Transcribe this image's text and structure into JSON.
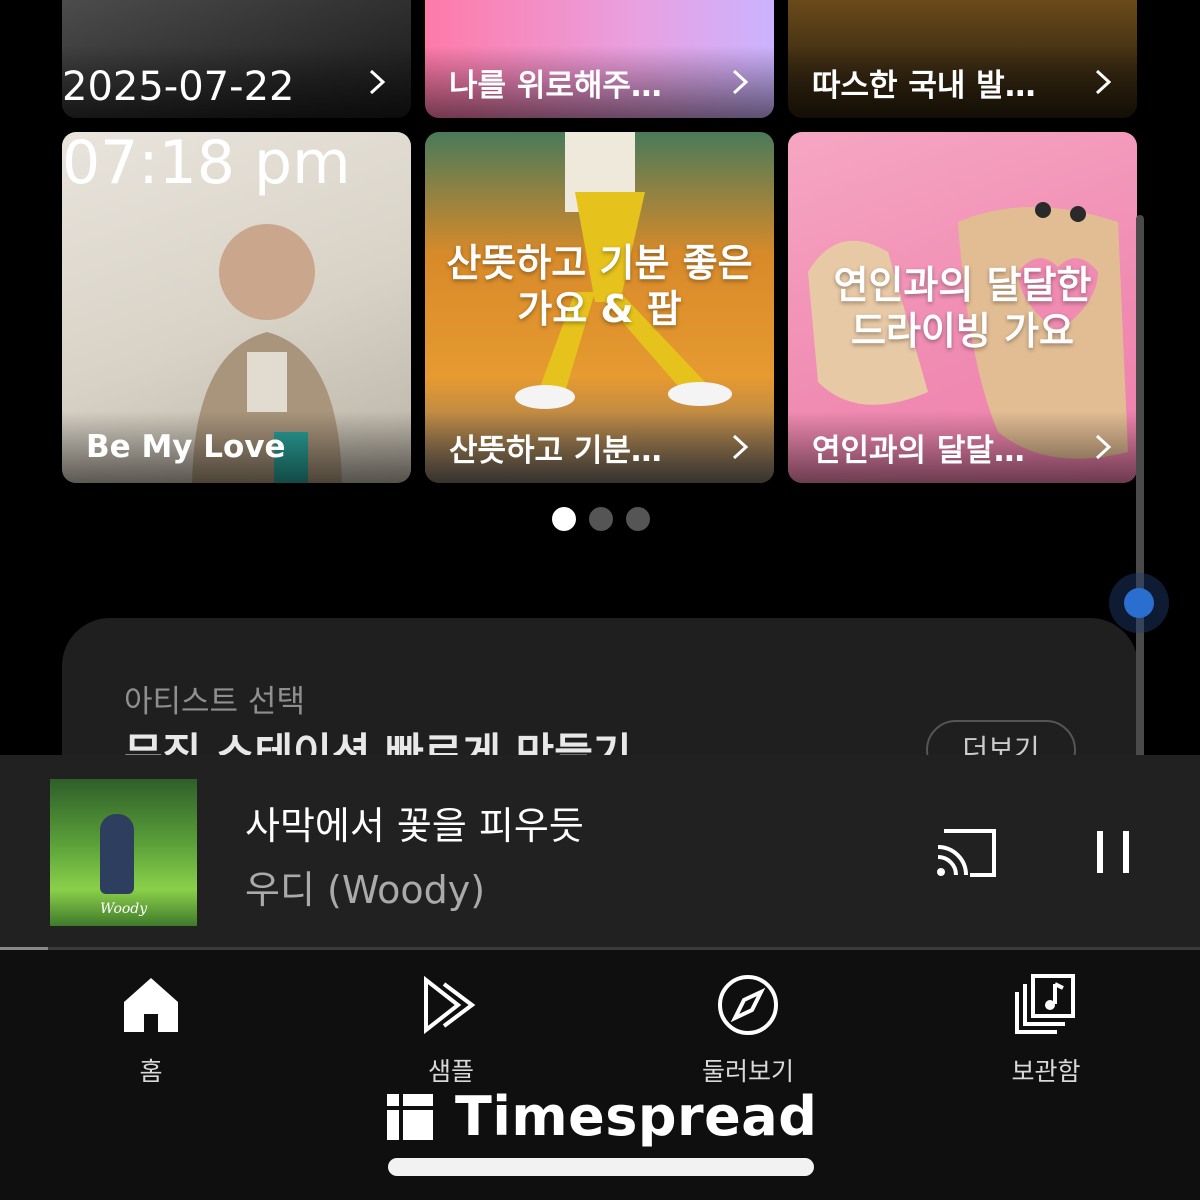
{
  "status": {
    "date": "2025-07-22",
    "time": "07:18 pm"
  },
  "top_row": [
    {
      "caption": "",
      "icon": "chevron-right-icon"
    },
    {
      "caption": "나를 위로해주…",
      "icon": "chevron-right-icon"
    },
    {
      "caption": "따스한 국내 발…",
      "icon": "chevron-right-icon"
    }
  ],
  "playlists": [
    {
      "caption": "Be My Love",
      "overlay_title": []
    },
    {
      "caption": "산뜻하고 기분…",
      "overlay_title": [
        "산뜻하고 기분 좋은",
        "가요 & 팝"
      ]
    },
    {
      "caption": "연인과의 달달…",
      "overlay_title": [
        "연인과의 달달한",
        "드라이빙 가요"
      ]
    }
  ],
  "carousel": {
    "pages": 3,
    "active": 0
  },
  "artist_section": {
    "kicker": "아티스트 선택",
    "headline": "뮤직 스테이션 빠르게 만들기",
    "more_label": "더보기"
  },
  "now_playing": {
    "title": "사막에서 꽃을 피우듯",
    "artist": "우디 (Woody)",
    "album_brand": "Woody",
    "progress": 0.04,
    "cast_icon": "cast-icon",
    "pause_icon": "pause-icon"
  },
  "nav": [
    {
      "label": "홈",
      "icon": "home-icon",
      "active": true
    },
    {
      "label": "샘플",
      "icon": "samples-play-icon",
      "active": false
    },
    {
      "label": "둘러보기",
      "icon": "compass-icon",
      "active": false
    },
    {
      "label": "보관함",
      "icon": "library-icon",
      "active": false
    }
  ],
  "watermark": {
    "brand": "Timespread"
  },
  "colors": {
    "background": "#000000",
    "player": "#212121",
    "accent": "#2a6fd0"
  }
}
